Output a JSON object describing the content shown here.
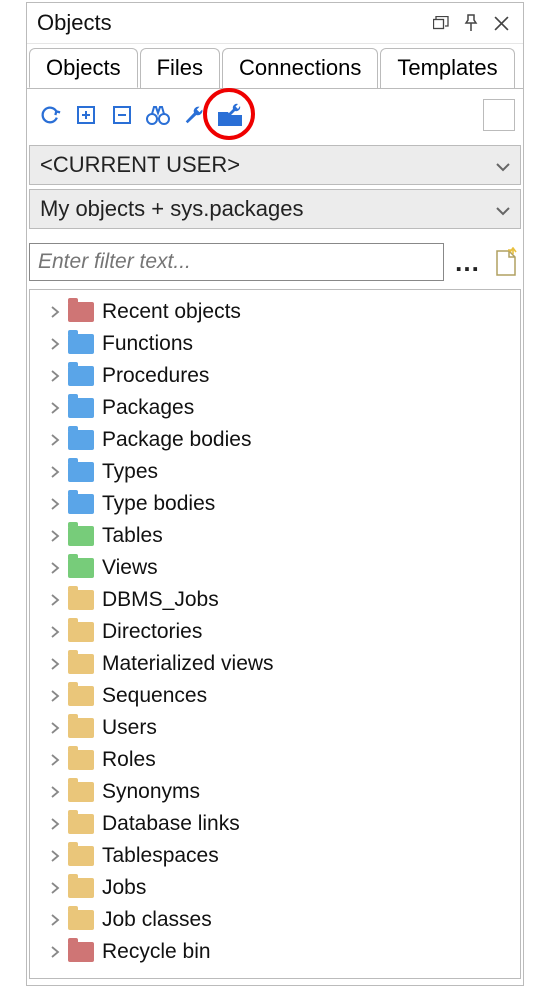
{
  "panel": {
    "title": "Objects"
  },
  "tabs": [
    {
      "label": "Objects",
      "active": true
    },
    {
      "label": "Files"
    },
    {
      "label": "Connections"
    },
    {
      "label": "Templates"
    }
  ],
  "toolbar": {
    "refresh_icon": "refresh",
    "expand_icon": "plus",
    "collapse_icon": "minus",
    "find_icon": "binoculars",
    "wrench_icon": "wrench",
    "wrenchfolder_icon": "wrench-folder"
  },
  "selectors": {
    "user": "<CURRENT USER>",
    "scope": "My objects + sys.packages"
  },
  "filter": {
    "placeholder": "Enter filter text..."
  },
  "tree": [
    {
      "label": "Recent objects",
      "color": "red"
    },
    {
      "label": "Functions",
      "color": "blue"
    },
    {
      "label": "Procedures",
      "color": "blue"
    },
    {
      "label": "Packages",
      "color": "blue"
    },
    {
      "label": "Package bodies",
      "color": "blue"
    },
    {
      "label": "Types",
      "color": "blue"
    },
    {
      "label": "Type bodies",
      "color": "blue"
    },
    {
      "label": "Tables",
      "color": "green"
    },
    {
      "label": "Views",
      "color": "green"
    },
    {
      "label": "DBMS_Jobs",
      "color": "tan"
    },
    {
      "label": "Directories",
      "color": "tan"
    },
    {
      "label": "Materialized views",
      "color": "tan"
    },
    {
      "label": "Sequences",
      "color": "tan"
    },
    {
      "label": "Users",
      "color": "tan"
    },
    {
      "label": "Roles",
      "color": "tan"
    },
    {
      "label": "Synonyms",
      "color": "tan"
    },
    {
      "label": "Database links",
      "color": "tan"
    },
    {
      "label": "Tablespaces",
      "color": "tan"
    },
    {
      "label": "Jobs",
      "color": "tan"
    },
    {
      "label": "Job classes",
      "color": "tan"
    },
    {
      "label": "Recycle bin",
      "color": "red"
    }
  ]
}
